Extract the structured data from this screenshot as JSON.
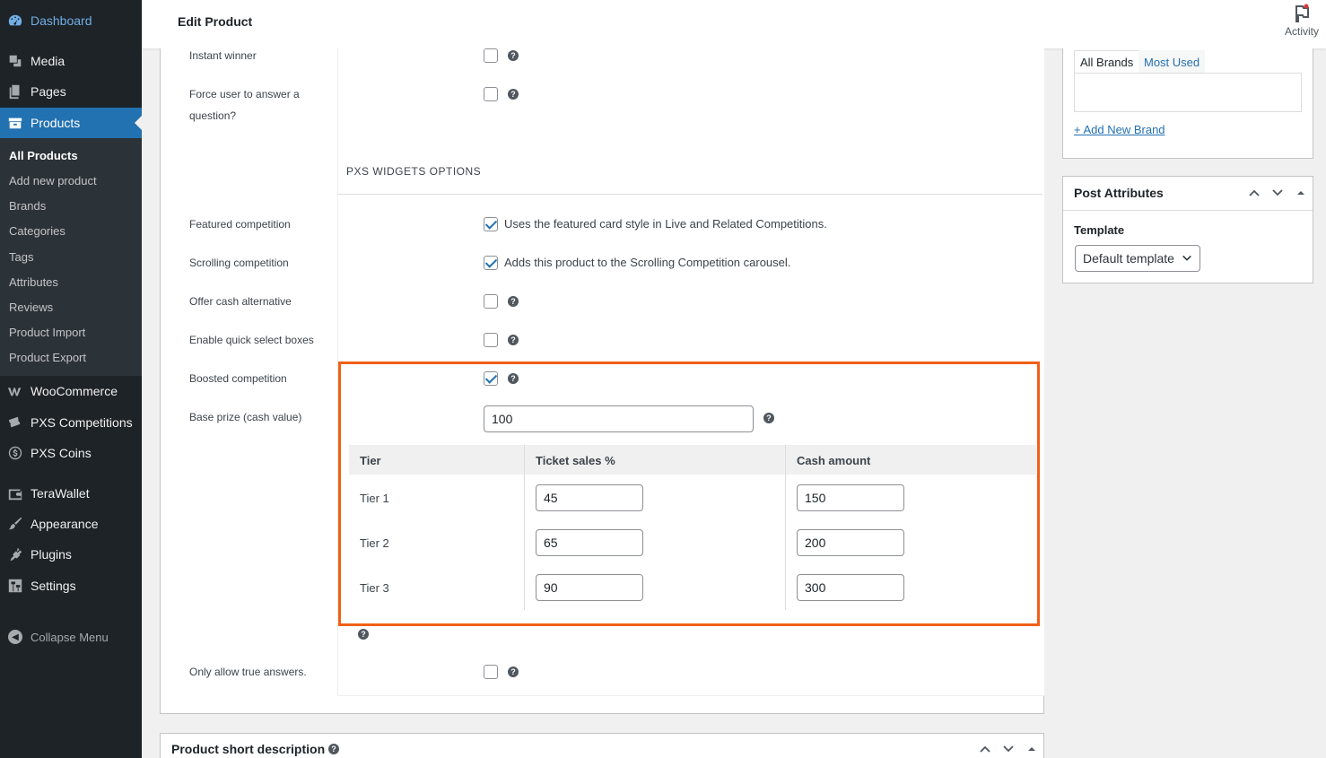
{
  "sidebar": {
    "dashboard": "Dashboard",
    "media": "Media",
    "pages": "Pages",
    "products": "Products",
    "submenu": [
      "All Products",
      "Add new product",
      "Brands",
      "Categories",
      "Tags",
      "Attributes",
      "Reviews",
      "Product Import",
      "Product Export"
    ],
    "woocommerce": "WooCommerce",
    "pxs_competitions": "PXS Competitions",
    "pxs_coins": "PXS Coins",
    "terawallet": "TeraWallet",
    "appearance": "Appearance",
    "plugins": "Plugins",
    "settings": "Settings",
    "collapse": "Collapse Menu"
  },
  "header": {
    "title": "Edit Product",
    "activity": "Activity"
  },
  "options": {
    "instant_winner": "Instant winner",
    "force_answer": "Force user to answer a question?",
    "section_heading": "PXS WIDGETS OPTIONS",
    "featured_label": "Featured competition",
    "featured_desc": "Uses the featured card style in Live and Related Competitions.",
    "scrolling_label": "Scrolling competition",
    "scrolling_desc": "Adds this product to the Scrolling Competition carousel.",
    "cash_alt_label": "Offer cash alternative",
    "quick_select_label": "Enable quick select boxes",
    "boosted_label": "Boosted competition",
    "base_prize_label": "Base prize (cash value)",
    "base_prize_value": "100",
    "only_true_label": "Only allow true answers."
  },
  "tiers": {
    "headers": [
      "Tier",
      "Ticket sales %",
      "Cash amount"
    ],
    "rows": [
      {
        "tier": "Tier 1",
        "sales": "45",
        "cash": "150"
      },
      {
        "tier": "Tier 2",
        "sales": "65",
        "cash": "200"
      },
      {
        "tier": "Tier 3",
        "sales": "90",
        "cash": "300"
      }
    ]
  },
  "brands": {
    "tab_all": "All Brands",
    "tab_used": "Most Used",
    "add_new": "+ Add New Brand"
  },
  "post_attributes": {
    "title": "Post Attributes",
    "template_label": "Template",
    "template_value": "Default template"
  },
  "short_description": {
    "title": "Product short description"
  },
  "colors": {
    "highlight": "#f06018",
    "accent": "#2271b1"
  }
}
